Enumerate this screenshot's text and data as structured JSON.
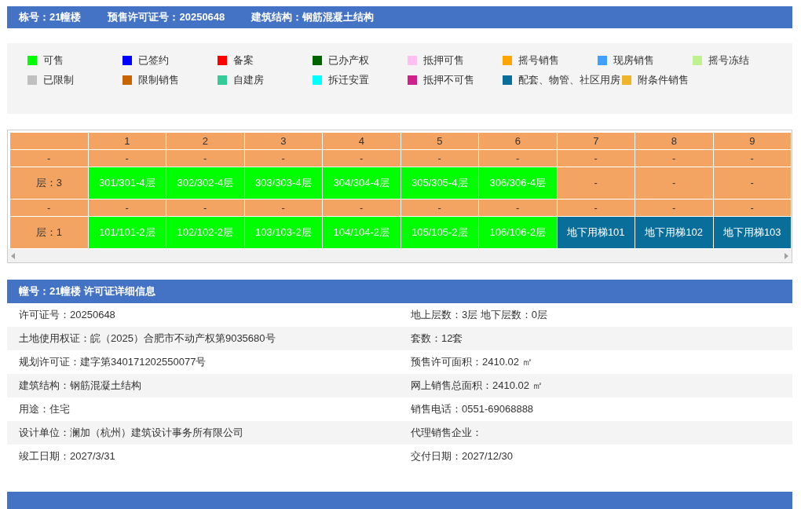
{
  "header": [
    {
      "label": "栋号：",
      "value": "21幢楼"
    },
    {
      "label": "预售许可证号：",
      "value": "20250648"
    },
    {
      "label": "建筑结构：",
      "value": "钢筋混凝土结构"
    }
  ],
  "legend": [
    {
      "label": "可售",
      "color": "#00ff00"
    },
    {
      "label": "已签约",
      "color": "#0000ff"
    },
    {
      "label": "备案",
      "color": "#ff0000"
    },
    {
      "label": "已办产权",
      "color": "#006400"
    },
    {
      "label": "抵押可售",
      "color": "#ffc0f0"
    },
    {
      "label": "摇号销售",
      "color": "#ffa500"
    },
    {
      "label": "现房销售",
      "color": "#3fa0ff"
    },
    {
      "label": "摇号冻结",
      "color": "#c0f090"
    },
    {
      "label": "已限制",
      "color": "#c0c0c0"
    },
    {
      "label": "限制销售",
      "color": "#c86400"
    },
    {
      "label": "自建房",
      "color": "#33cc99"
    },
    {
      "label": "拆迁安置",
      "color": "#00ffff"
    },
    {
      "label": "抵押不可售",
      "color": "#d0208a"
    },
    {
      "label": "配套、物管、社区用房",
      "color": "#0a6e9a"
    },
    {
      "label": "附条件销售",
      "color": "#f0b428"
    }
  ],
  "grid": {
    "columns": [
      "1",
      "2",
      "3",
      "4",
      "5",
      "6",
      "7",
      "8",
      "9"
    ],
    "rows": [
      {
        "label": "-",
        "cells": [
          {
            "text": "-"
          },
          {
            "text": "-"
          },
          {
            "text": "-"
          },
          {
            "text": "-"
          },
          {
            "text": "-"
          },
          {
            "text": "-"
          },
          {
            "text": "-"
          },
          {
            "text": "-"
          },
          {
            "text": "-"
          }
        ]
      },
      {
        "label": "层：3",
        "cells": [
          {
            "text": "301/301-4层",
            "color": "#00ff00"
          },
          {
            "text": "302/302-4层",
            "color": "#00ff00"
          },
          {
            "text": "303/303-4层",
            "color": "#00ff00"
          },
          {
            "text": "304/304-4层",
            "color": "#00ff00"
          },
          {
            "text": "305/305-4层",
            "color": "#00ff00"
          },
          {
            "text": "306/306-4层",
            "color": "#00ff00"
          },
          {
            "text": "-"
          },
          {
            "text": "-"
          },
          {
            "text": "-"
          }
        ]
      },
      {
        "label": "-",
        "cells": [
          {
            "text": "-"
          },
          {
            "text": "-"
          },
          {
            "text": "-"
          },
          {
            "text": "-"
          },
          {
            "text": "-"
          },
          {
            "text": "-"
          },
          {
            "text": "-"
          },
          {
            "text": "-"
          },
          {
            "text": "-"
          }
        ]
      },
      {
        "label": "层：1",
        "cells": [
          {
            "text": "101/101-2层",
            "color": "#00ff00"
          },
          {
            "text": "102/102-2层",
            "color": "#00ff00"
          },
          {
            "text": "103/103-2层",
            "color": "#00ff00"
          },
          {
            "text": "104/104-2层",
            "color": "#00ff00"
          },
          {
            "text": "105/105-2层",
            "color": "#00ff00"
          },
          {
            "text": "106/106-2层",
            "color": "#00ff00"
          },
          {
            "text": "地下用梯101",
            "color": "#0a6e9a"
          },
          {
            "text": "地下用梯102",
            "color": "#0a6e9a"
          },
          {
            "text": "地下用梯103",
            "color": "#0a6e9a"
          }
        ]
      }
    ]
  },
  "details": {
    "title": "幢号：21幢楼 许可证详细信息",
    "rows": [
      [
        "许可证号：20250648",
        "地上层数：3层  地下层数：0层"
      ],
      [
        "土地使用权证：皖（2025）合肥市不动产权第9035680号",
        "套数：12套"
      ],
      [
        "规划许可证：建字第340171202550077号",
        "预售许可面积：2410.02 ㎡"
      ],
      [
        "建筑结构：钢筋混凝土结构",
        "网上销售总面积：2410.02 ㎡"
      ],
      [
        "用途：住宅",
        "销售电话：0551-69068888"
      ],
      [
        "设计单位：澜加（杭州）建筑设计事务所有限公司",
        "代理销售企业："
      ],
      [
        "竣工日期：2027/3/31",
        "交付日期：2027/12/30"
      ]
    ]
  }
}
